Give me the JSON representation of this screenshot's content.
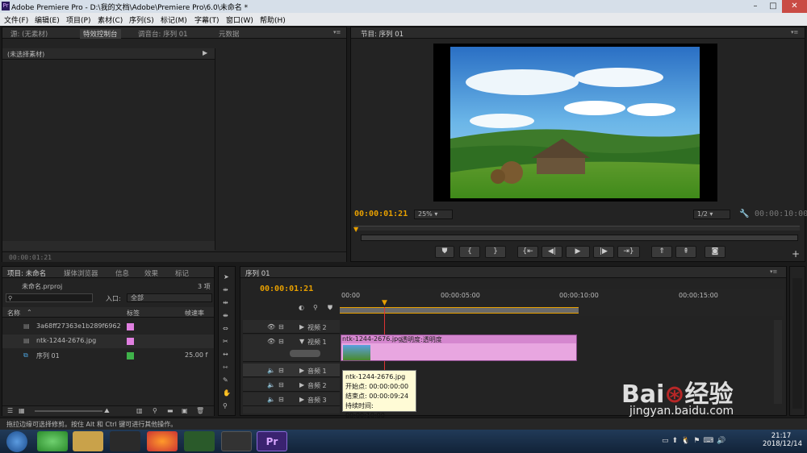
{
  "window": {
    "title": "Adobe Premiere Pro - D:\\我的文档\\Adobe\\Premiere Pro\\6.0\\未命名 *",
    "app_icon": "Pr"
  },
  "menu": [
    "文件(F)",
    "编辑(E)",
    "项目(P)",
    "素材(C)",
    "序列(S)",
    "标记(M)",
    "字幕(T)",
    "窗口(W)",
    "帮助(H)"
  ],
  "source_panel": {
    "tabs": [
      "源: (无素材)",
      "特效控制台",
      "调音台: 序列 01",
      "元数据"
    ],
    "no_clip": "(未选择素材)",
    "timecode": "00:00:01:21"
  },
  "program": {
    "tab": "节目: 序列 01",
    "timecode": "00:00:01:21",
    "zoom": "25%",
    "resolution": "1/2",
    "duration": "00:00:10:00"
  },
  "project": {
    "tabs": [
      "项目: 未命名",
      "媒体浏览器",
      "信息",
      "效果",
      "标记"
    ],
    "file": "未命名.prproj",
    "count": "3 项",
    "in_label": "入口:",
    "in_value": "全部",
    "search_placeholder": "",
    "columns": [
      "名称",
      "标签",
      "帧速率"
    ],
    "items": [
      {
        "name": "3a68ff27363e1b289f69628",
        "label_color": "#e07fe0",
        "rate": ""
      },
      {
        "name": "ntk-1244-2676.jpg",
        "label_color": "#e07fe0",
        "rate": ""
      },
      {
        "name": "序列 01",
        "label_color": "#3fb24a",
        "rate": "25.00 f"
      }
    ]
  },
  "timeline": {
    "tab": "序列 01",
    "timecode": "00:00:01:21",
    "ruler": [
      "00:00",
      "00:00:05:00",
      "00:00:10:00",
      "00:00:15:00"
    ],
    "tracks": [
      "视频 2",
      "视频 1",
      "音频 1",
      "音频 2",
      "音频 3"
    ],
    "clip_name": "ntk-1244-2676.jpg",
    "clip_effect": "透明度:透明度",
    "tooltip": {
      "name": "ntk-1244-2676.jpg",
      "start": "开始点: 00:00:00:00",
      "end": "结束点: 00:00:09:24",
      "duration": "持续时间: 00:00:10:00"
    }
  },
  "status": "拖拉边缘可选择修剪。按住 Alt 和 Ctrl 键可进行其他操作。",
  "clock": {
    "time": "21:17",
    "date": "2018/12/14"
  },
  "watermark": {
    "brand": "Bai du 经验",
    "url": "jingyan.baidu.com"
  }
}
